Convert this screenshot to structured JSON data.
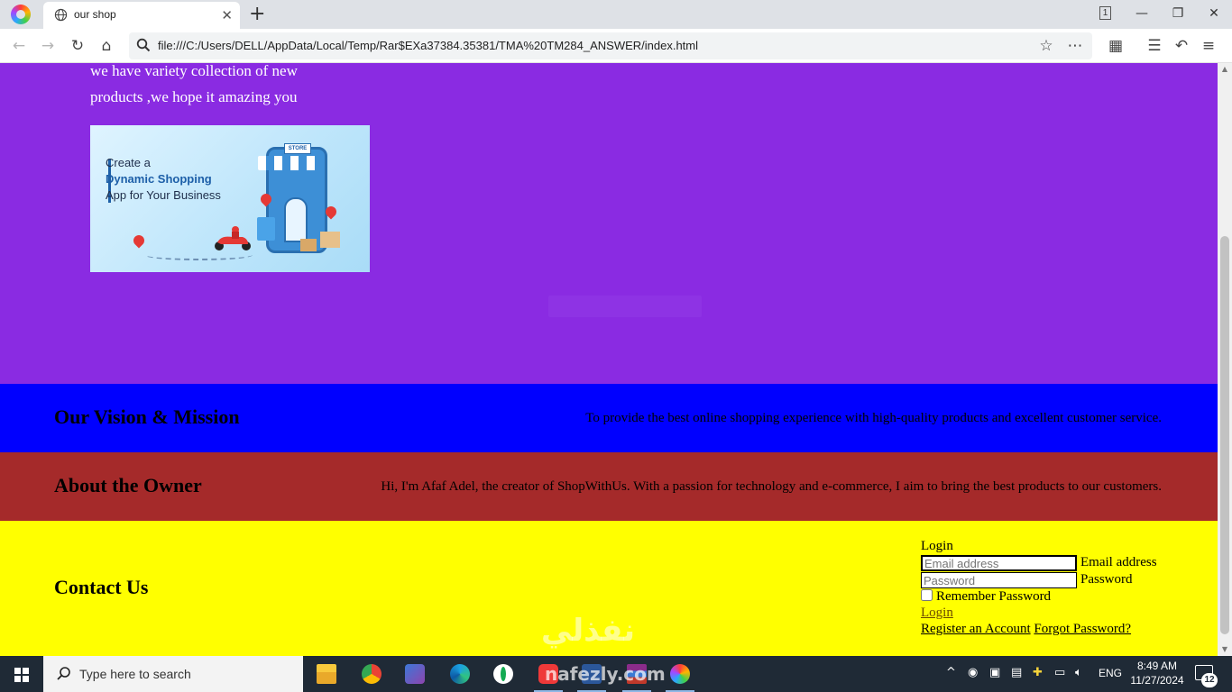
{
  "browser": {
    "tab_title": "our shop",
    "tab_count": "1",
    "url": "file:///C:/Users/DELL/AppData/Local/Temp/Rar$EXa37384.35381/TMA%20TM284_ANSWER/index.html"
  },
  "hero": {
    "text": "we have variety collection of new products ,we hope it amazing you",
    "promo": {
      "line1": "Create a",
      "line2": "Dynamic Shopping",
      "line3": "App for Your Business",
      "store_sign": "STORE"
    }
  },
  "vision": {
    "title": "Our Vision & Mission",
    "text": "To provide the best online shopping experience with high-quality products and excellent customer service."
  },
  "owner": {
    "title": "About the Owner",
    "text": "Hi, I'm Afaf Adel, the creator of ShopWithUs. With a passion for technology and e-commerce, I aim to bring the best products to our customers."
  },
  "contact": {
    "title": "Contact Us",
    "login_heading": "Login",
    "email_placeholder": "Email address",
    "email_label": "Email address",
    "password_placeholder": "Password",
    "password_label": "Password",
    "remember_label": "Remember Password",
    "login_link": "Login",
    "register_link": "Register an Account",
    "forgot_link": "Forgot Password?"
  },
  "watermark": {
    "arabic": "نفذلي",
    "latin": "nafezly.com"
  },
  "taskbar": {
    "search_placeholder": "Type here to search",
    "language": "ENG",
    "time": "8:49 AM",
    "date": "11/27/2024",
    "notification_count": "12"
  },
  "colors": {
    "hero_bg": "#8a2be2",
    "vision_bg": "#0000ff",
    "owner_bg": "#a52a2a",
    "contact_bg": "#ffff00"
  }
}
